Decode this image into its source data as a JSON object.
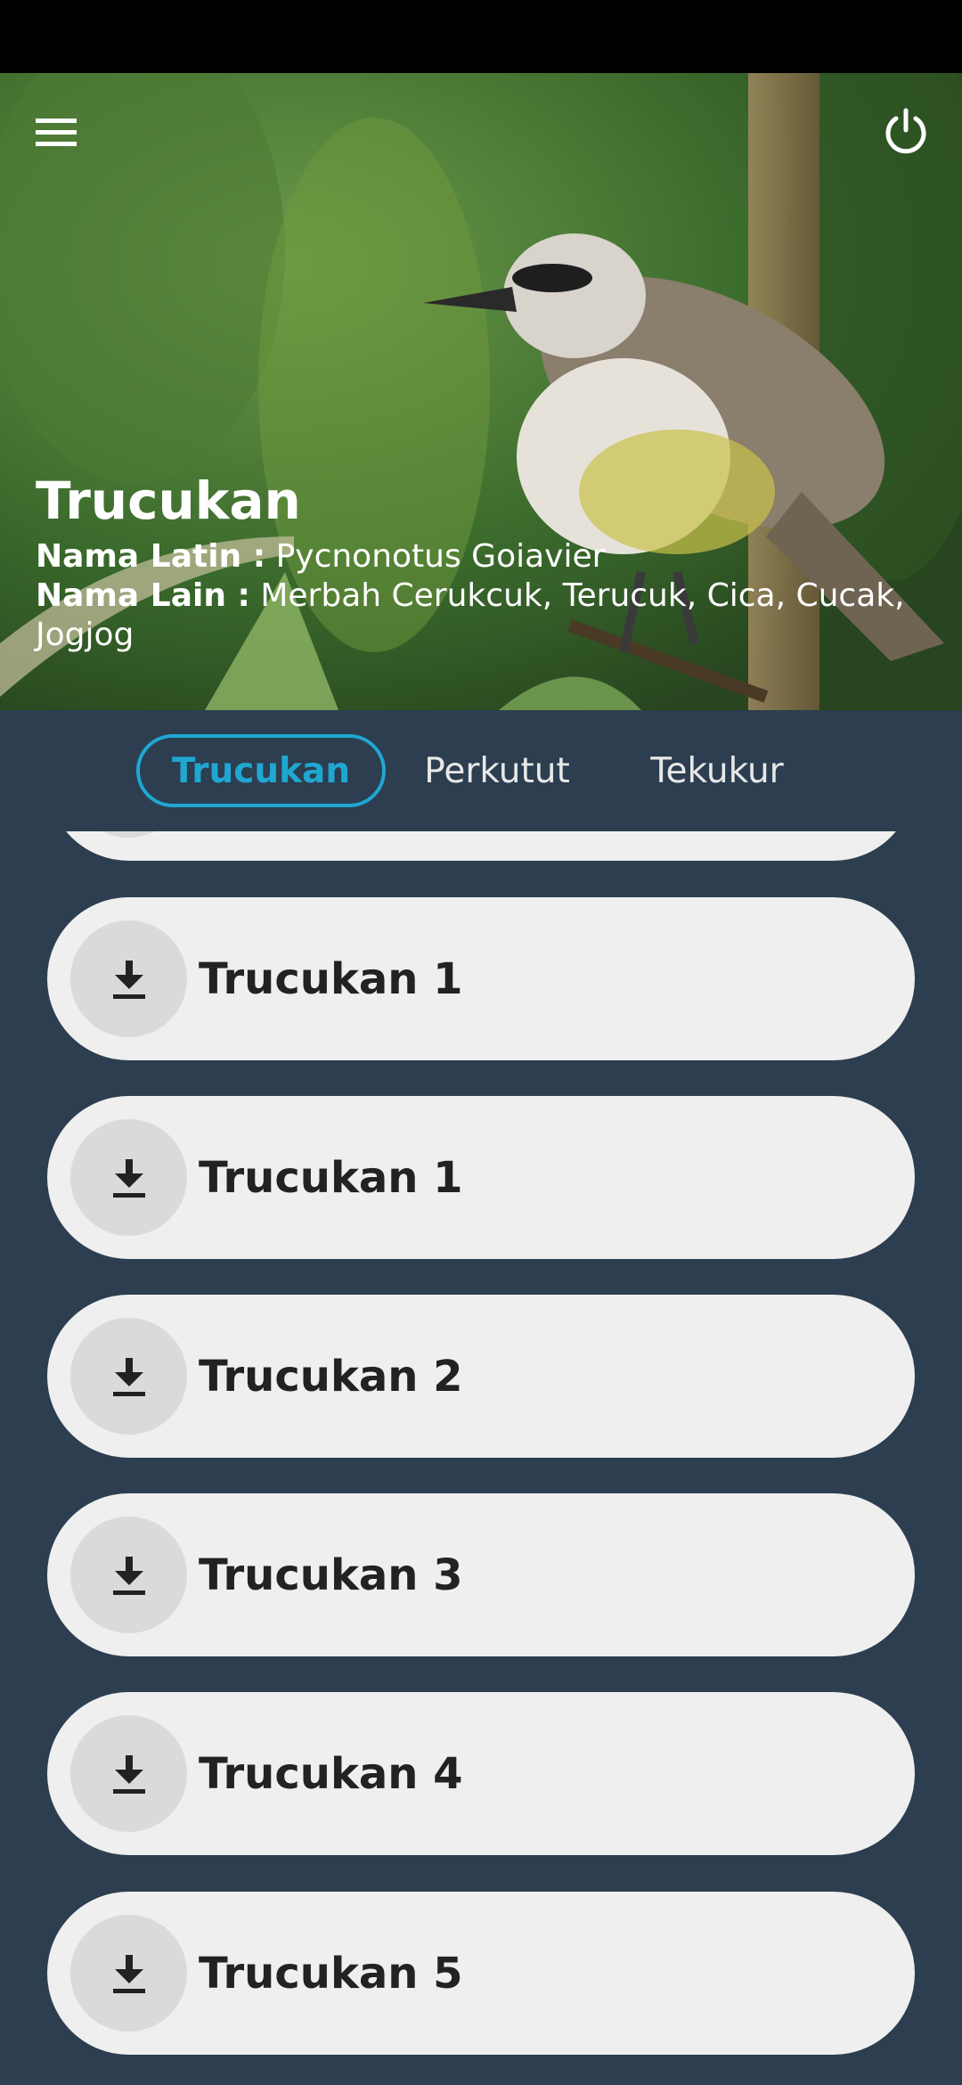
{
  "header": {
    "title": "Trucukan",
    "latin_label": "Nama Latin :",
    "latin_value": "Pycnonotus Goiavier",
    "other_label": "Nama Lain :",
    "other_value": "Merbah Cerukcuk, Terucuk, Cica, Cucak, Jogjog",
    "menu_icon": "hamburger-menu-icon",
    "power_icon": "power-icon"
  },
  "tabs": [
    {
      "label": "Trucukan",
      "active": true
    },
    {
      "label": "Perkutut",
      "active": false
    },
    {
      "label": "Tekukur",
      "active": false
    }
  ],
  "list": {
    "item_icon": "download-icon",
    "items": [
      {
        "label": ""
      },
      {
        "label": "Trucukan 1"
      },
      {
        "label": "Trucukan 1"
      },
      {
        "label": "Trucukan 2"
      },
      {
        "label": "Trucukan 3"
      },
      {
        "label": "Trucukan 4"
      },
      {
        "label": "Trucukan 5"
      }
    ]
  },
  "colors": {
    "background": "#2c3e50",
    "accent": "#1fa7d1",
    "item_bg": "#efefef"
  }
}
